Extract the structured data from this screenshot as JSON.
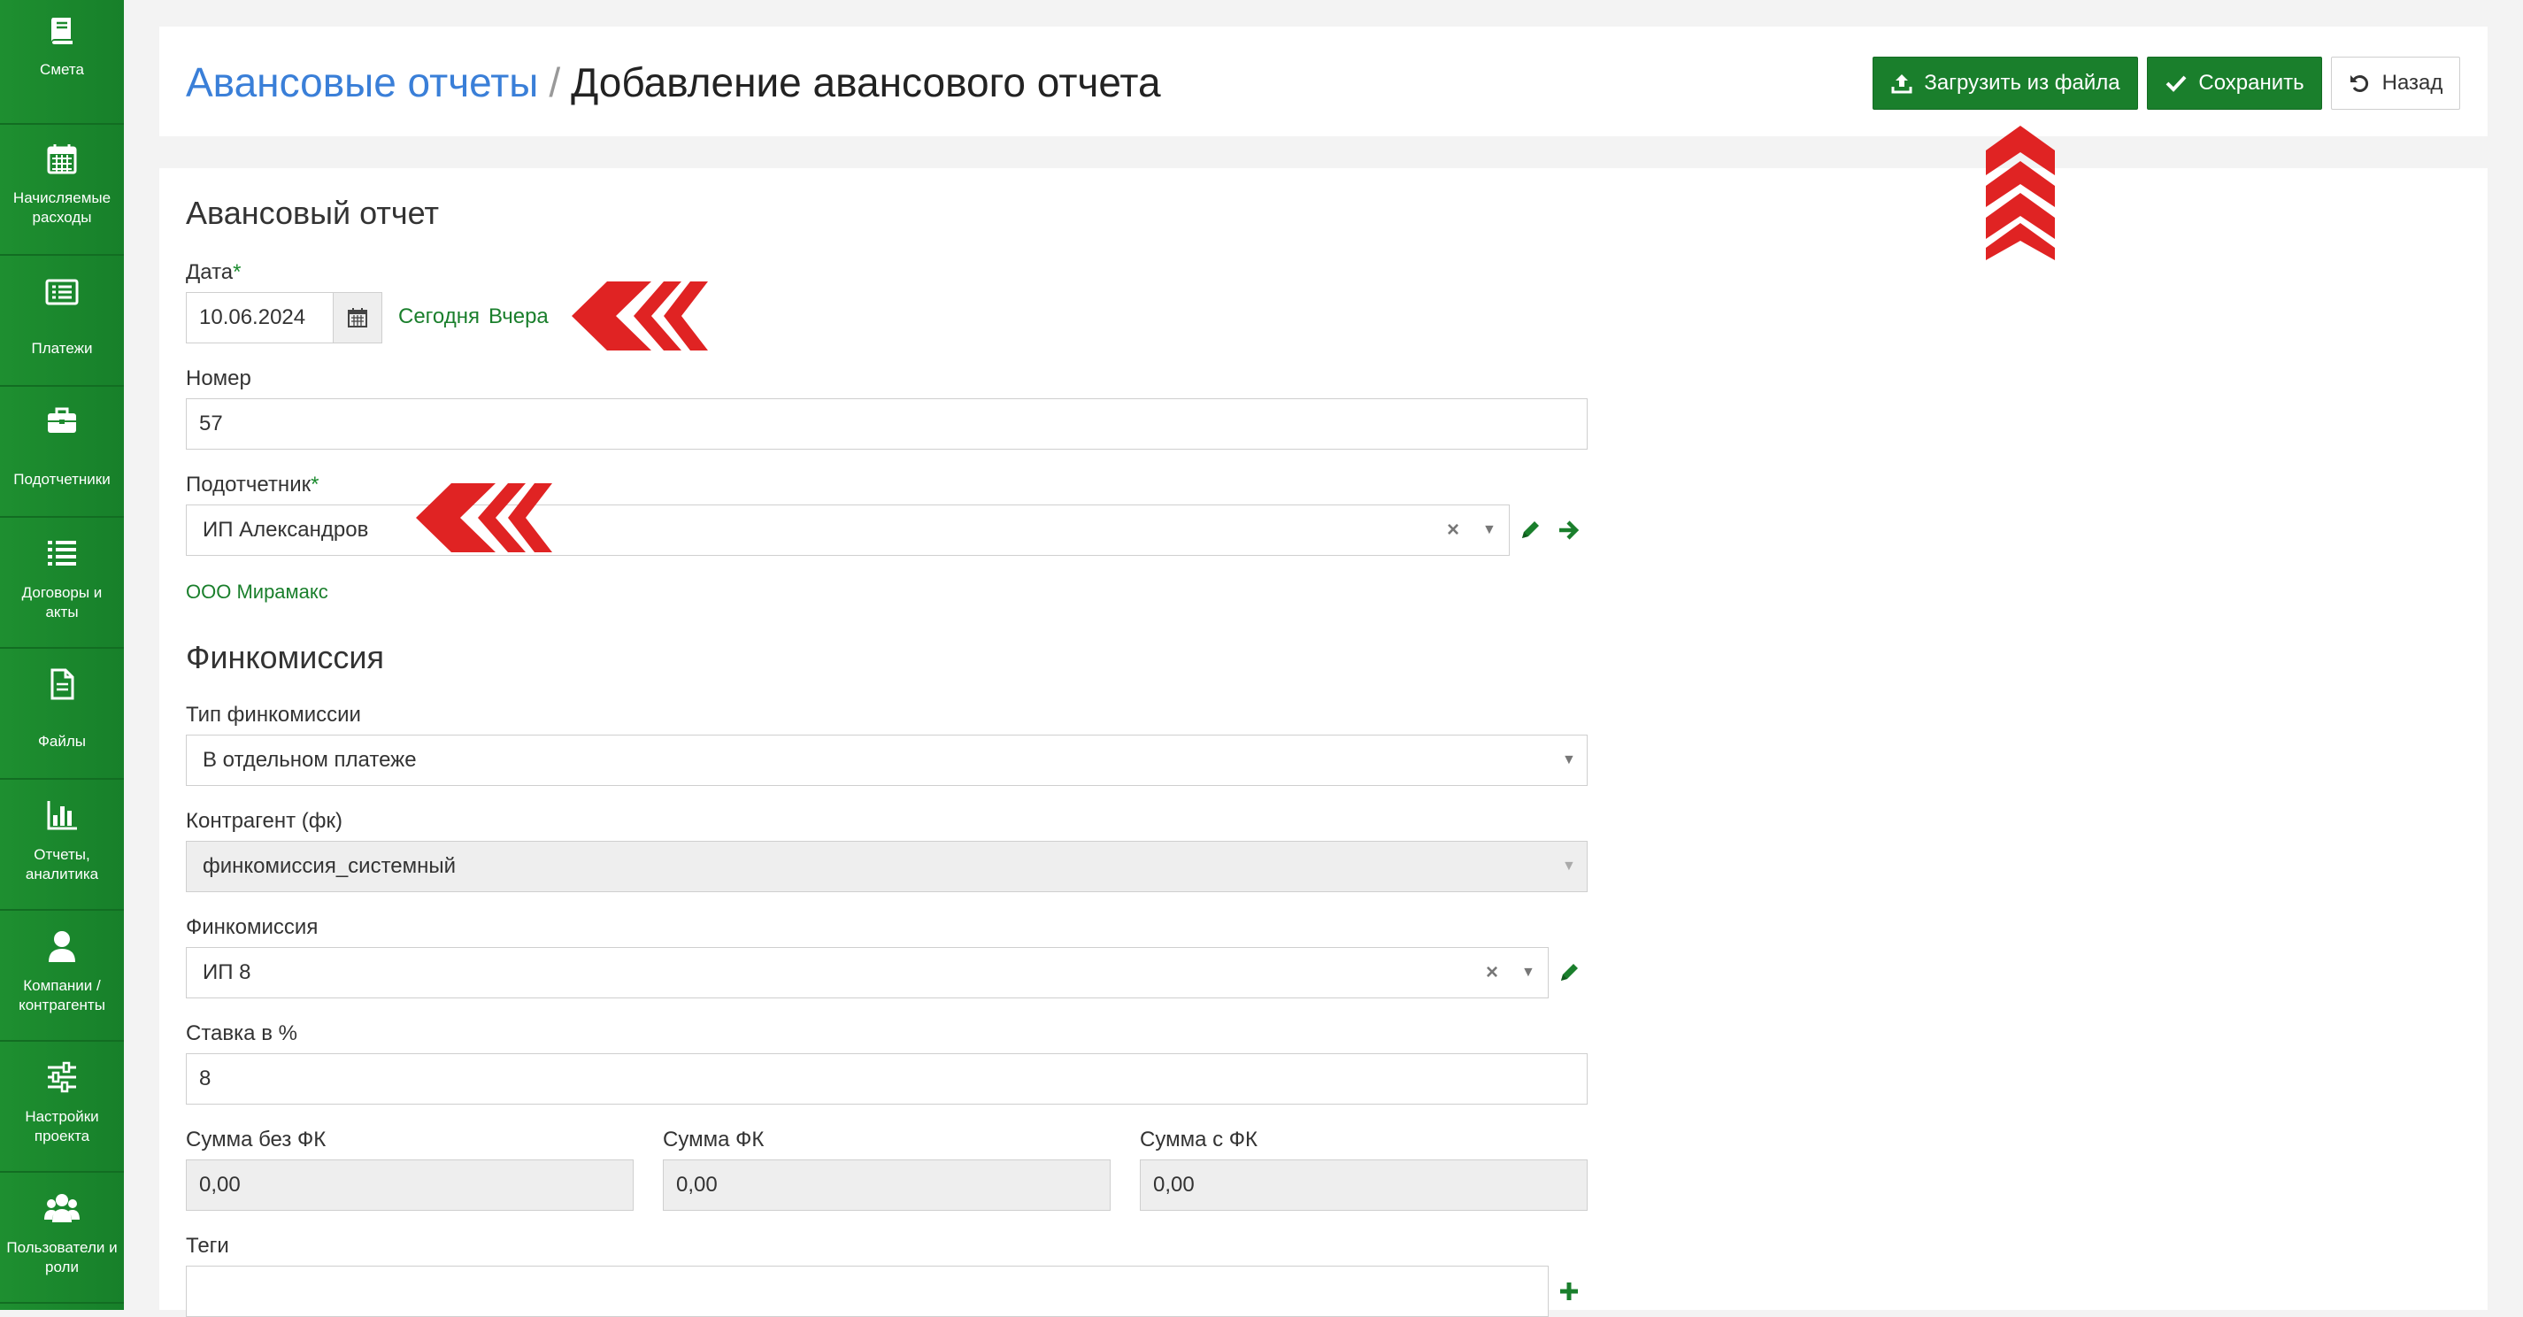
{
  "sidebar": {
    "items": [
      {
        "label": "Смета",
        "icon": "book-icon"
      },
      {
        "label": "Начисляемые расходы",
        "icon": "calendar-icon"
      },
      {
        "label": "Платежи",
        "icon": "payments-list-icon"
      },
      {
        "label": "Подотчетники",
        "icon": "briefcase-icon"
      },
      {
        "label": "Договоры и акты",
        "icon": "list-icon"
      },
      {
        "label": "Файлы",
        "icon": "file-icon"
      },
      {
        "label": "Отчеты, аналитика",
        "icon": "bar-chart-icon"
      },
      {
        "label": "Компании / контрагенты",
        "icon": "user-icon"
      },
      {
        "label": "Настройки проекта",
        "icon": "sliders-icon"
      },
      {
        "label": "Пользователи и роли",
        "icon": "users-icon"
      }
    ]
  },
  "header": {
    "breadcrumb_parent": "Авансовые отчеты",
    "breadcrumb_separator": "/",
    "title": "Добавление авансового отчета",
    "upload_button": "Загрузить из файла",
    "save_button": "Сохранить",
    "back_button": "Назад"
  },
  "form": {
    "section_report": "Авансовый отчет",
    "date_label": "Дата",
    "required_mark": "*",
    "date_value": "10.06.2024",
    "today_link": "Сегодня",
    "yesterday_link": "Вчера",
    "number_label": "Номер",
    "number_value": "57",
    "accountable_label": "Подотчетник",
    "accountable_value": "ИП Александров",
    "company_link": "ООО Мирамакс",
    "section_fincommission": "Финкомиссия",
    "fc_type_label": "Тип финкомиссии",
    "fc_type_value": "В отдельном платеже",
    "counterparty_label": "Контрагент (фк)",
    "counterparty_value": "финкомиссия_системный",
    "fincommission_label": "Финкомиссия",
    "fincommission_value": "ИП 8",
    "rate_label": "Ставка в %",
    "rate_value": "8",
    "sum_without_label": "Сумма без ФК",
    "sum_without_value": "0,00",
    "sum_fc_label": "Сумма ФК",
    "sum_fc_value": "0,00",
    "sum_with_label": "Сумма с ФК",
    "sum_with_value": "0,00",
    "tags_label": "Теги",
    "tags_value": ""
  },
  "colors": {
    "sidebar": "#1d8a2e",
    "primary_green": "#1a7f2c",
    "link_blue": "#3a7fd8",
    "annotation_red": "#e02323"
  }
}
